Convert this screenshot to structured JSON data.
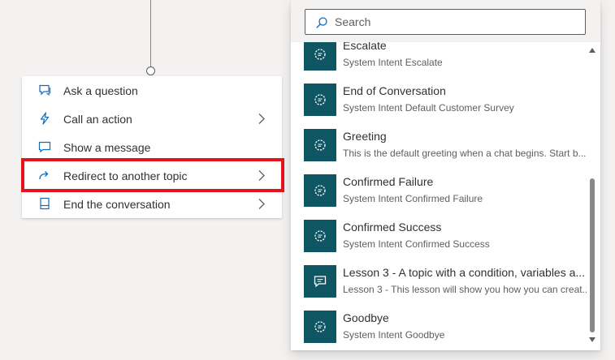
{
  "canvas": {
    "connector": "connector-node"
  },
  "action_menu": {
    "items": [
      {
        "label": "Ask a question",
        "icon": "chat-question-icon",
        "has_submenu": false
      },
      {
        "label": "Call an action",
        "icon": "lightning-icon",
        "has_submenu": true
      },
      {
        "label": "Show a message",
        "icon": "message-icon",
        "has_submenu": false
      },
      {
        "label": "Redirect to another topic",
        "icon": "redirect-arrow-icon",
        "has_submenu": true,
        "highlighted": true
      },
      {
        "label": "End the conversation",
        "icon": "end-conversation-icon",
        "has_submenu": true
      }
    ],
    "highlight_color": "#e3141c"
  },
  "topic_picker": {
    "search": {
      "placeholder": "Search",
      "value": ""
    },
    "topics": [
      {
        "title": "Escalate",
        "description": "System Intent Escalate",
        "icon": "system-topic-gear-icon"
      },
      {
        "title": "End of Conversation",
        "description": "System Intent Default Customer Survey",
        "icon": "system-topic-gear-icon"
      },
      {
        "title": "Greeting",
        "description": "This is the default greeting when a chat begins. Start b...",
        "icon": "system-topic-gear-icon"
      },
      {
        "title": "Confirmed Failure",
        "description": "System Intent Confirmed Failure",
        "icon": "system-topic-gear-icon"
      },
      {
        "title": "Confirmed Success",
        "description": "System Intent Confirmed Success",
        "icon": "system-topic-gear-icon"
      },
      {
        "title": "Lesson 3 - A topic with a condition, variables a...",
        "description": "Lesson 3 - This lesson will show you how you can creat...",
        "icon": "custom-topic-chat-icon"
      },
      {
        "title": "Goodbye",
        "description": "System Intent Goodbye",
        "icon": "system-topic-gear-icon"
      }
    ],
    "icon_bg_color": "#0e5662"
  }
}
